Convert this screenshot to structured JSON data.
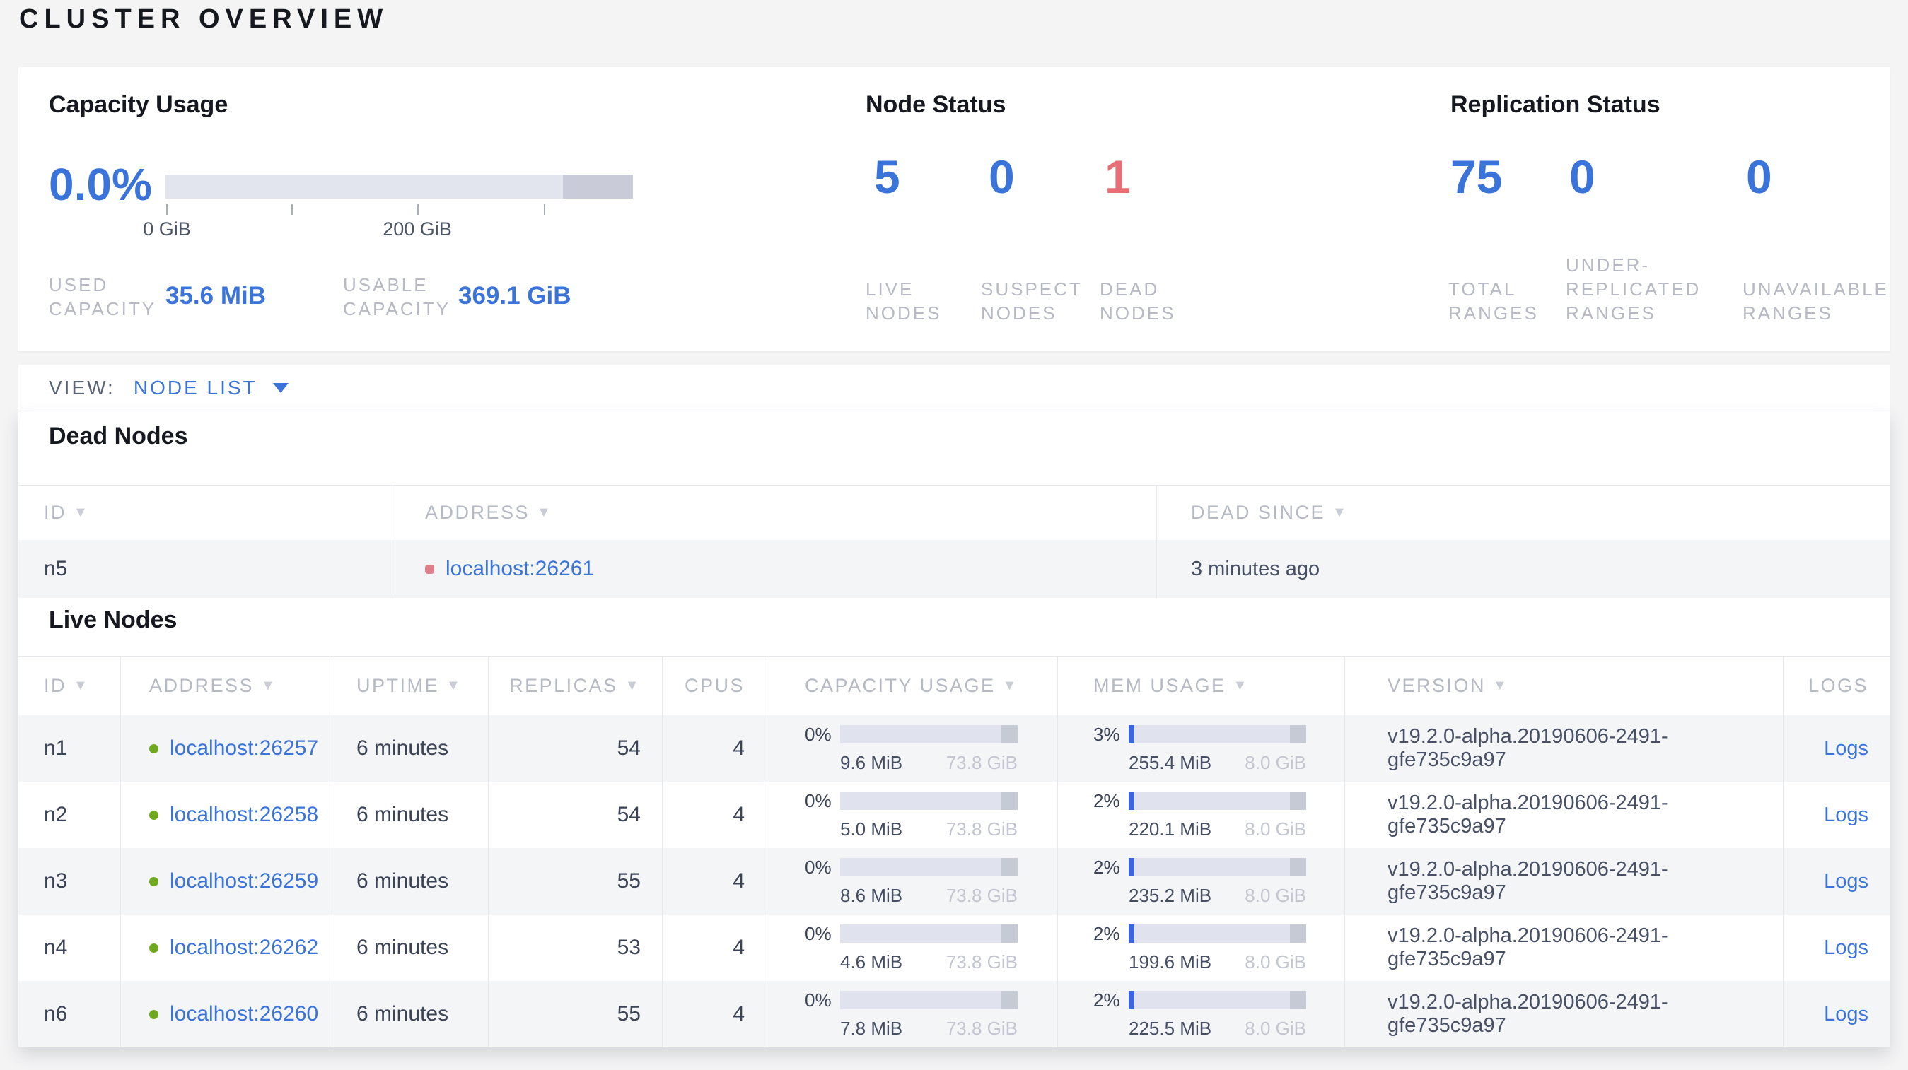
{
  "title": "CLUSTER OVERVIEW",
  "colors": {
    "accent_blue": "#3a74da",
    "danger_red": "#e86e76",
    "live_dot_green": "#70a81e",
    "dead_dot_red": "#de7e8a",
    "bar_track": "#e0e3ed",
    "bar_tail": "#c6cad5",
    "bar_fill_blue": "#3d65e0",
    "row_stripe": "#f4f5f7"
  },
  "summary": {
    "capacity": {
      "heading": "Capacity Usage",
      "percent": "0.0%",
      "bar": {
        "non_usable_from_pct": 85,
        "tick_labels": [
          "0 GiB",
          "200 GiB"
        ]
      },
      "used_label": "USED\nCAPACITY",
      "used_value": "35.6 MiB",
      "usable_label": "USABLE\nCAPACITY",
      "usable_value": "369.1 GiB"
    },
    "node_status": {
      "heading": "Node Status",
      "stats": [
        {
          "value": "5",
          "label": "LIVE\nNODES",
          "tone": "blue"
        },
        {
          "value": "0",
          "label": "SUSPECT\nNODES",
          "tone": "blue"
        },
        {
          "value": "1",
          "label": "DEAD\nNODES",
          "tone": "red"
        }
      ]
    },
    "replication": {
      "heading": "Replication Status",
      "stats": [
        {
          "value": "75",
          "label": "TOTAL\nRANGES",
          "tone": "blue"
        },
        {
          "value": "0",
          "label": "UNDER-\nREPLICATED\nRANGES",
          "tone": "blue"
        },
        {
          "value": "0",
          "label": "UNAVAILABLE\nRANGES",
          "tone": "blue"
        }
      ]
    }
  },
  "view_bar": {
    "label": "VIEW:",
    "selected": "NODE LIST"
  },
  "dead_nodes": {
    "heading": "Dead Nodes",
    "columns": [
      {
        "label": "ID",
        "sortable": true
      },
      {
        "label": "ADDRESS",
        "sortable": true
      },
      {
        "label": "DEAD SINCE",
        "sortable": true
      }
    ],
    "sort_arrow": "▼",
    "rows": [
      {
        "id": "n5",
        "address": "localhost:26261",
        "dead_since": "3 minutes ago"
      }
    ]
  },
  "live_nodes": {
    "heading": "Live Nodes",
    "columns": [
      {
        "label": "ID",
        "sortable": true
      },
      {
        "label": "ADDRESS",
        "sortable": true
      },
      {
        "label": "UPTIME",
        "sortable": true
      },
      {
        "label": "REPLICAS",
        "sortable": true
      },
      {
        "label": "CPUS",
        "sortable": false
      },
      {
        "label": "CAPACITY USAGE",
        "sortable": true
      },
      {
        "label": "MEM USAGE",
        "sortable": true
      },
      {
        "label": "VERSION",
        "sortable": true
      },
      {
        "label": "LOGS",
        "sortable": false
      }
    ],
    "sort_arrow": "▼",
    "rows": [
      {
        "id": "n1",
        "address": "localhost:26257",
        "uptime": "6 minutes",
        "replicas": "54",
        "cpus": "4",
        "capacity": {
          "pct_label": "0%",
          "pct": 0,
          "used": "9.6 MiB",
          "total": "73.8 GiB"
        },
        "memory": {
          "pct_label": "3%",
          "pct": 3,
          "used": "255.4 MiB",
          "total": "8.0 GiB"
        },
        "version": "v19.2.0-alpha.20190606-2491-gfe735c9a97",
        "logs": "Logs"
      },
      {
        "id": "n2",
        "address": "localhost:26258",
        "uptime": "6 minutes",
        "replicas": "54",
        "cpus": "4",
        "capacity": {
          "pct_label": "0%",
          "pct": 0,
          "used": "5.0 MiB",
          "total": "73.8 GiB"
        },
        "memory": {
          "pct_label": "2%",
          "pct": 2,
          "used": "220.1 MiB",
          "total": "8.0 GiB"
        },
        "version": "v19.2.0-alpha.20190606-2491-gfe735c9a97",
        "logs": "Logs"
      },
      {
        "id": "n3",
        "address": "localhost:26259",
        "uptime": "6 minutes",
        "replicas": "55",
        "cpus": "4",
        "capacity": {
          "pct_label": "0%",
          "pct": 0,
          "used": "8.6 MiB",
          "total": "73.8 GiB"
        },
        "memory": {
          "pct_label": "2%",
          "pct": 2,
          "used": "235.2 MiB",
          "total": "8.0 GiB"
        },
        "version": "v19.2.0-alpha.20190606-2491-gfe735c9a97",
        "logs": "Logs"
      },
      {
        "id": "n4",
        "address": "localhost:26262",
        "uptime": "6 minutes",
        "replicas": "53",
        "cpus": "4",
        "capacity": {
          "pct_label": "0%",
          "pct": 0,
          "used": "4.6 MiB",
          "total": "73.8 GiB"
        },
        "memory": {
          "pct_label": "2%",
          "pct": 2,
          "used": "199.6 MiB",
          "total": "8.0 GiB"
        },
        "version": "v19.2.0-alpha.20190606-2491-gfe735c9a97",
        "logs": "Logs"
      },
      {
        "id": "n6",
        "address": "localhost:26260",
        "uptime": "6 minutes",
        "replicas": "55",
        "cpus": "4",
        "capacity": {
          "pct_label": "0%",
          "pct": 0,
          "used": "7.8 MiB",
          "total": "73.8 GiB"
        },
        "memory": {
          "pct_label": "2%",
          "pct": 2,
          "used": "225.5 MiB",
          "total": "8.0 GiB"
        },
        "version": "v19.2.0-alpha.20190606-2491-gfe735c9a97",
        "logs": "Logs"
      }
    ]
  }
}
